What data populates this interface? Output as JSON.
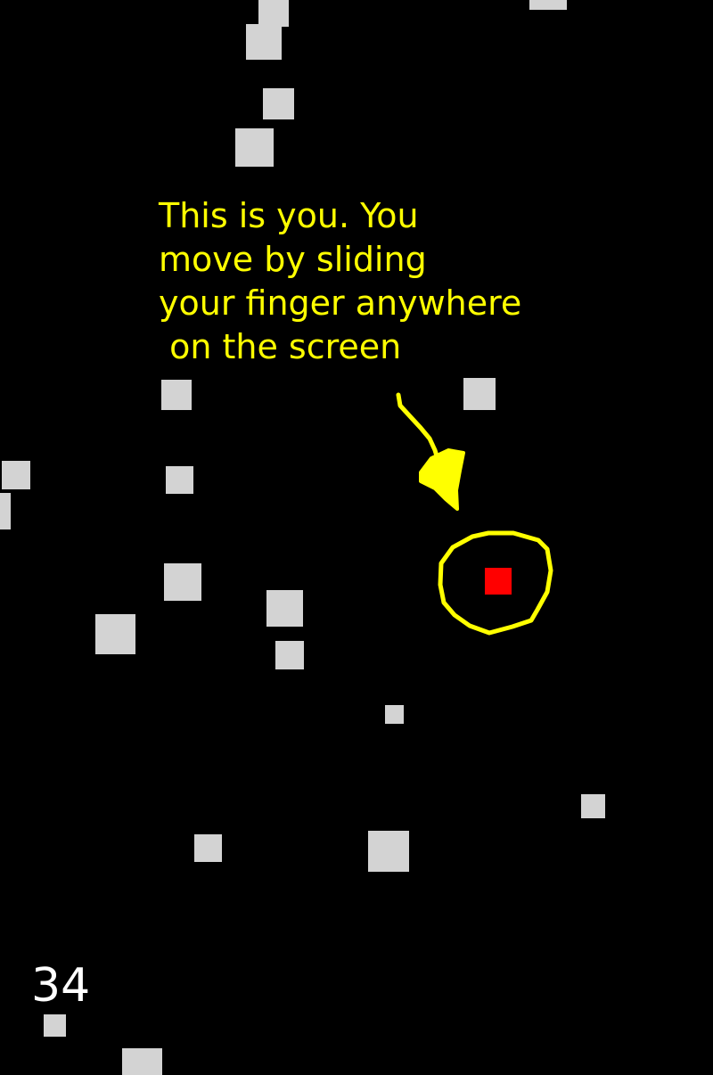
{
  "tutorial": {
    "text": "This is you. You\nmove by sliding\nyour finger anywhere\n on the screen"
  },
  "hud": {
    "score": "34"
  },
  "colors": {
    "background": "#000000",
    "obstacle": "#d3d3d3",
    "player": "#ff0000",
    "annotation": "#ffff00",
    "score": "#ffffff"
  }
}
